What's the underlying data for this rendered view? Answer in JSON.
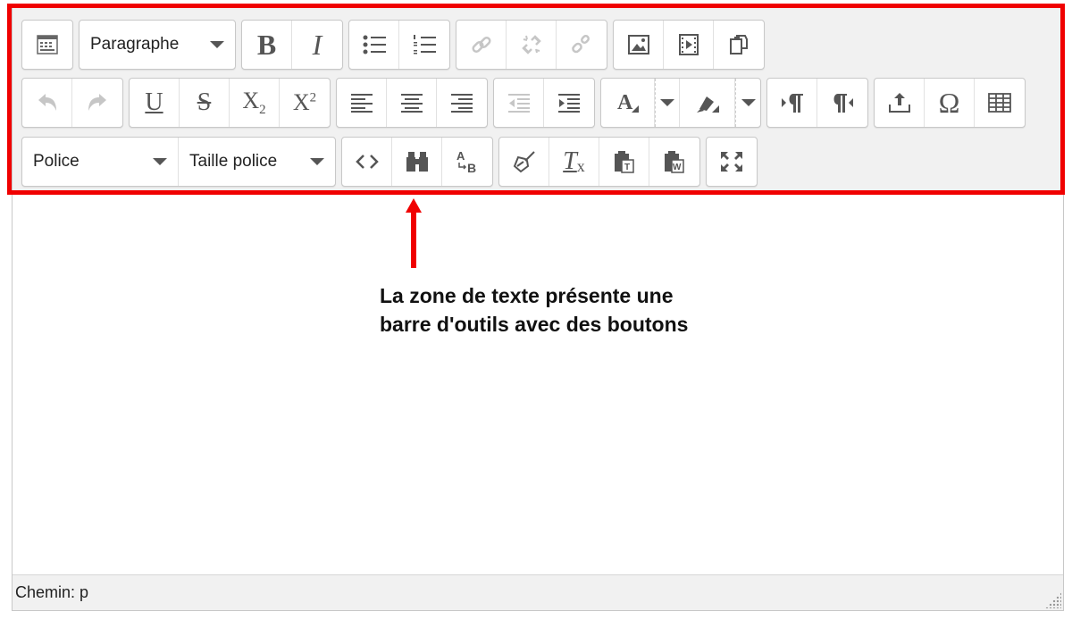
{
  "toolbar": {
    "format_select": "Paragraphe",
    "font_select": "Police",
    "size_select": "Taille police"
  },
  "status_bar": {
    "path": "Chemin: p"
  },
  "annotation": {
    "text": "La zone de texte présente une barre d'outils avec des boutons",
    "color": "#f00000"
  },
  "icons": [
    "toolbar-toggle",
    "bold",
    "italic",
    "bullet-list",
    "numbered-list",
    "link",
    "unlink",
    "anchor",
    "image",
    "media",
    "paste-special",
    "undo",
    "redo",
    "underline",
    "strikethrough",
    "subscript",
    "superscript",
    "align-left",
    "align-center",
    "align-right",
    "outdent",
    "indent",
    "text-color",
    "background-color",
    "ltr",
    "rtl",
    "upload",
    "special-char",
    "table",
    "source-code",
    "find-replace",
    "spellcheck",
    "clean-html",
    "clear-formatting",
    "paste-text",
    "paste-word",
    "fullscreen"
  ]
}
